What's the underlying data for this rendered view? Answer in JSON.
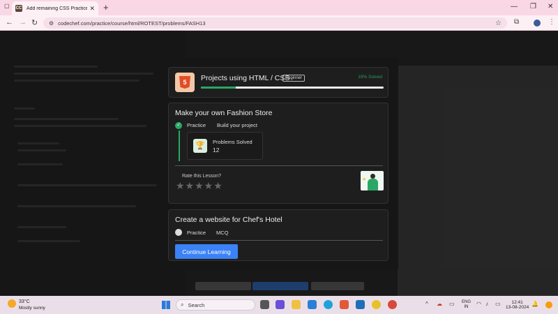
{
  "browser": {
    "tab_title": "Add remaining CSS Practice Pr",
    "tab_favicon": "CC",
    "url": "codechef.com/practice/course/html/ROTEST/problems/FASH13"
  },
  "modal": {
    "course": {
      "badge": "5",
      "title": "Projects using HTML / CSS",
      "level": "Beginner",
      "solved": "19% Solved",
      "progress_fraction": 0.19
    },
    "section1": {
      "title": "Make your own Fashion Store",
      "practice": "Practice",
      "build": "Build your project",
      "problems_label": "Problems Solved",
      "problems_value": "12",
      "rate_label": "Rate this Lesson?",
      "stars": "★★★★★",
      "rating": 0
    },
    "section2": {
      "title": "Create a website for Chef's Hotel",
      "practice": "Practice",
      "mcq": "MCQ",
      "cta": "Continue Learning"
    }
  },
  "taskbar": {
    "temperature": "33°C",
    "weather": "Mostly sunny",
    "search": "Search",
    "lang1": "ENG",
    "lang2": "IN",
    "time": "12:41",
    "date": "13-08-2024"
  }
}
